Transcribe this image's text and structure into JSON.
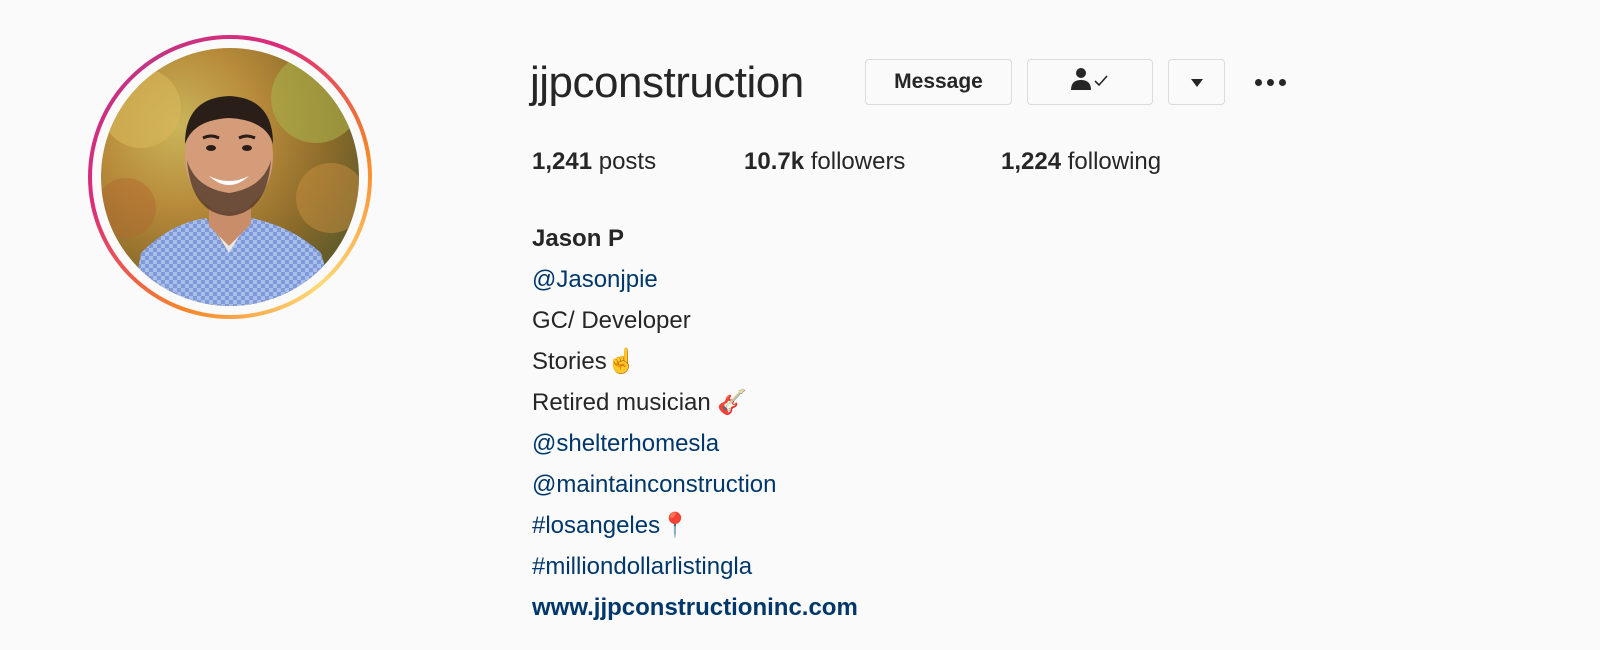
{
  "profile": {
    "username": "jjpconstruction",
    "avatar_alt": "profile-photo"
  },
  "actions": {
    "message_label": "Message",
    "following_icon": "person-check-icon",
    "dropdown_icon": "caret-down-icon",
    "more_icon": "more-dots-icon"
  },
  "stats": {
    "posts_count": "1,241",
    "posts_label": "posts",
    "followers_count": "10.7k",
    "followers_label": "followers",
    "following_count": "1,224",
    "following_label": "following"
  },
  "bio": {
    "name": "Jason P",
    "lines": [
      "@Jasonjpie",
      "GC/ Developer",
      "Stories☝️",
      "Retired musician 🎸",
      "@shelterhomesla",
      "@maintainconstruction",
      "#losangeles📍",
      "#milliondollarlistingla"
    ],
    "website": "www.jjpconstructioninc.com"
  },
  "colors": {
    "link": "#00376b",
    "text": "#262626",
    "border": "#dbdbdb",
    "background": "#fafafa"
  }
}
